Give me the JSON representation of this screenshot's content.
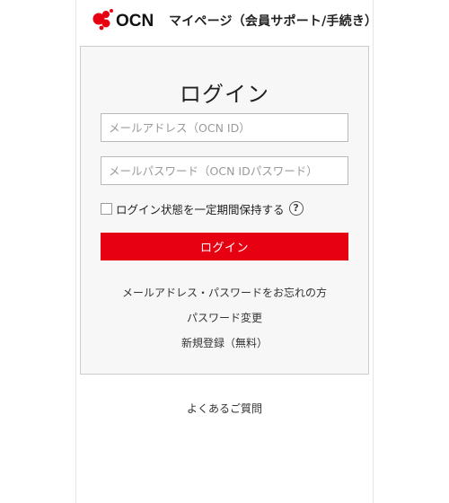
{
  "header": {
    "logo_text": "OCN",
    "title": "マイページ（会員サポート/手続き）"
  },
  "login": {
    "title": "ログイン",
    "email_placeholder": "メールアドレス（OCN ID）",
    "password_placeholder": "メールパスワード（OCN IDパスワード）",
    "keep_logged_in_label": "ログイン状態を一定期間保持する",
    "help_glyph": "?",
    "submit_label": "ログイン"
  },
  "links": {
    "forgot": "メールアドレス・パスワードをお忘れの方",
    "change_password": "パスワード変更",
    "signup": "新規登録（無料）",
    "faq": "よくあるご質問"
  },
  "colors": {
    "brand_red": "#e60012",
    "box_background": "#f7f7f7"
  }
}
